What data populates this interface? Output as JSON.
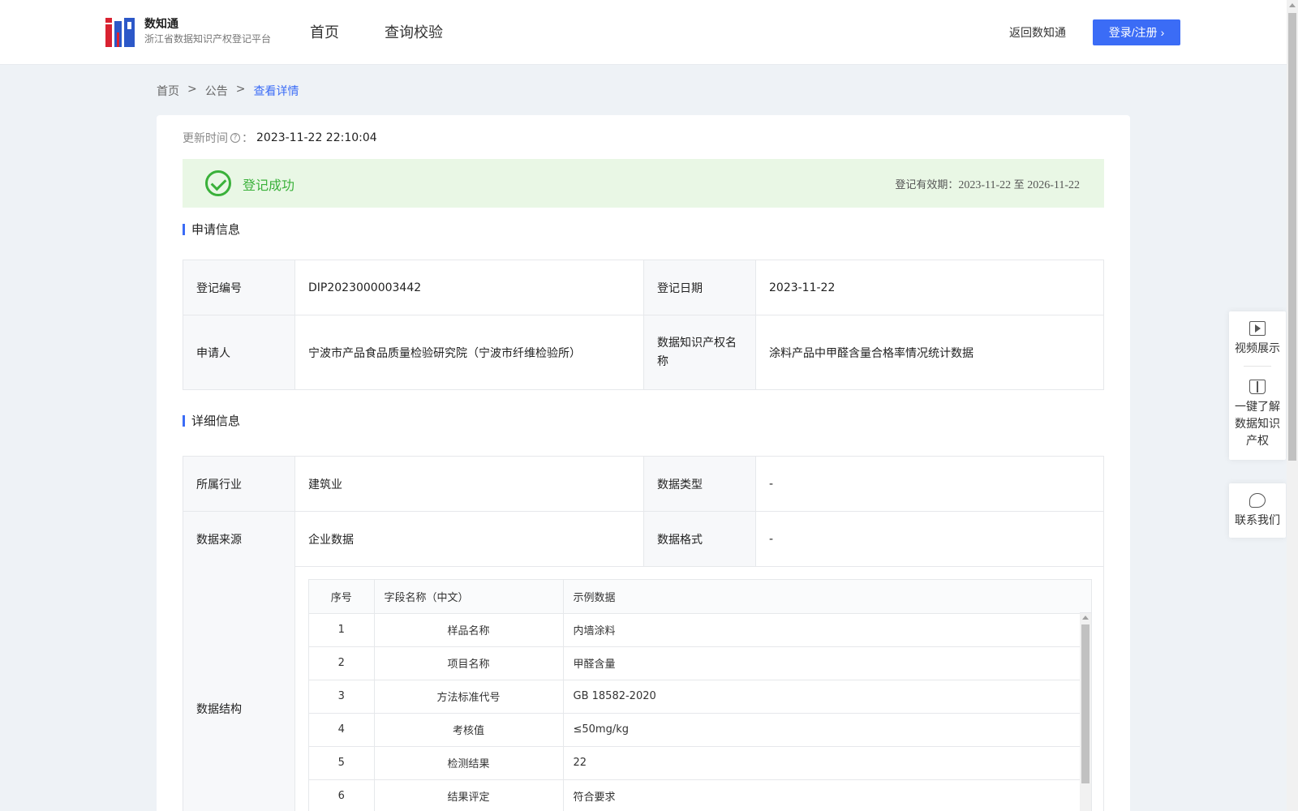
{
  "header": {
    "logo_title": "数知通",
    "logo_subtitle": "浙江省数据知识产权登记平台",
    "nav": [
      "首页",
      "查询校验"
    ],
    "back_link": "返回数知通",
    "login_button": "登录/注册",
    "login_icon": "chevron-right-icon"
  },
  "breadcrumb": {
    "items": [
      "首页",
      "公告",
      "查看详情"
    ],
    "separator": ">"
  },
  "detail": {
    "update_label": "更新时间",
    "update_suffix": "：",
    "update_value": "2023-11-22 22:10:04",
    "status_text": "登记成功",
    "validity_label": "登记有效期：",
    "validity_start": "2023-11-22",
    "validity_to": "至",
    "validity_end": "2026-11-22",
    "status_color": "#3ab13a"
  },
  "application": {
    "title": "申请信息",
    "rows": [
      {
        "k1": "登记编号",
        "v1": "DIP2023000003442",
        "k2": "登记日期",
        "v2": "2023-11-22"
      },
      {
        "k1": "申请人",
        "v1": "宁波市产品食品质量检验研究院（宁波市纤维检验所）",
        "k2": "数据知识产权名称",
        "v2": "涂料产品中甲醛含量合格率情况统计数据"
      }
    ]
  },
  "details_info": {
    "title": "详细信息",
    "rows": [
      {
        "k1": "所属行业",
        "v1": "建筑业",
        "k2": "数据类型",
        "v2": "-"
      },
      {
        "k1": "数据来源",
        "v1": "企业数据",
        "k2": "数据格式",
        "v2": "-"
      }
    ],
    "structure_label": "数据结构",
    "structure_headers": [
      "序号",
      "字段名称（中文）",
      "示例数据"
    ],
    "structure_rows": [
      [
        "1",
        "样品名称",
        "内墙涂料"
      ],
      [
        "2",
        "项目名称",
        "甲醛含量"
      ],
      [
        "3",
        "方法标准代号",
        "GB 18582-2020"
      ],
      [
        "4",
        "考核值",
        "≤50mg/kg"
      ],
      [
        "5",
        "检测结果",
        "22"
      ],
      [
        "6",
        "结果评定",
        "符合要求"
      ]
    ]
  },
  "side_panel": {
    "video": "视频展示",
    "learn": "一键了解数据知识产权",
    "contact": "联系我们",
    "icons": [
      "video-icon",
      "book-icon",
      "phone-icon"
    ]
  },
  "accent_color": "#3b6cf6"
}
